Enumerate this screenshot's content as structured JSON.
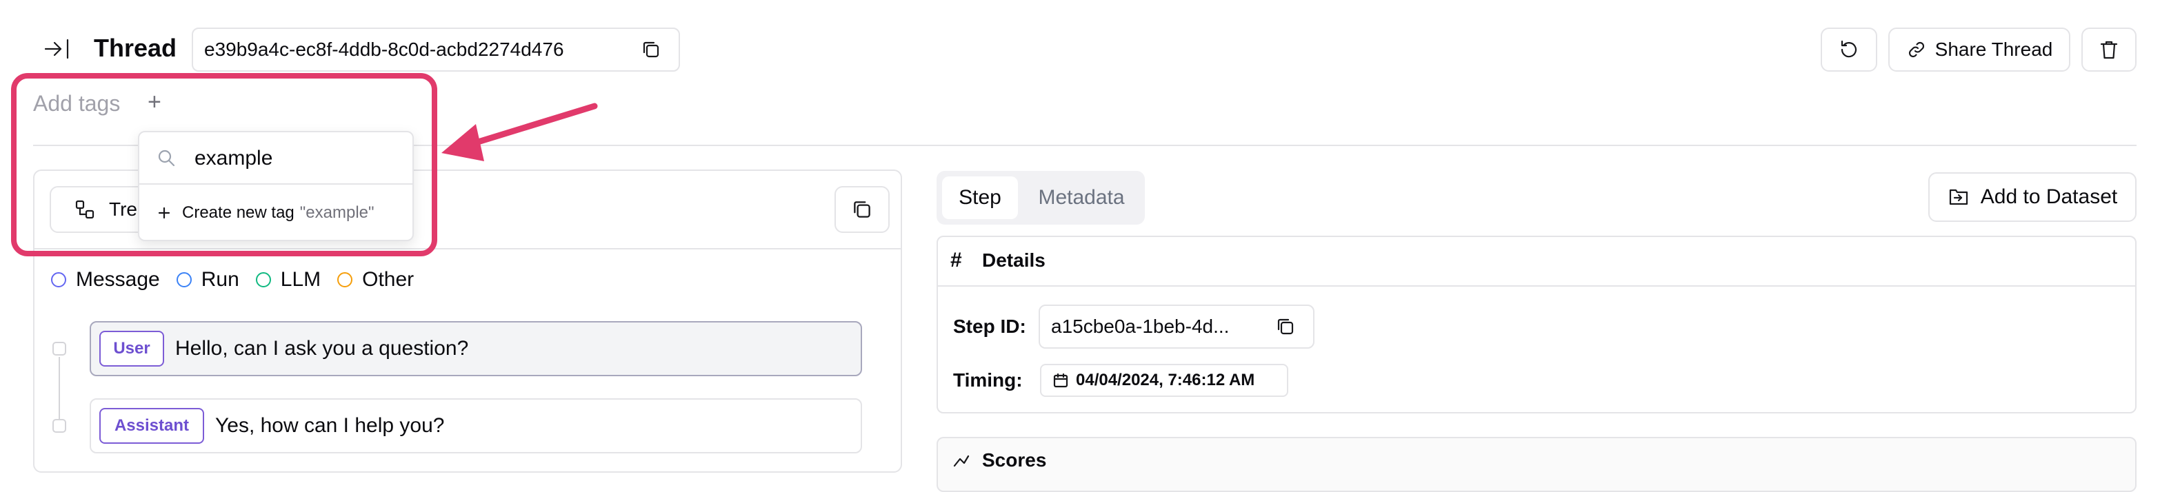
{
  "header": {
    "title": "Thread",
    "thread_id": "e39b9a4c-ec8f-4ddb-8c0d-acbd2274d476",
    "share_label": "Share Thread"
  },
  "tags": {
    "placeholder": "Add tags",
    "plus": "+",
    "dropdown": {
      "search_value": "example",
      "create_prefix": "Create new tag",
      "create_value": "\"example\""
    }
  },
  "left_panel": {
    "tree_tab_label": "Tree",
    "legend": [
      {
        "label": "Message",
        "color": "#6366f1"
      },
      {
        "label": "Run",
        "color": "#3b82f6"
      },
      {
        "label": "LLM",
        "color": "#10b981"
      },
      {
        "label": "Other",
        "color": "#f59e0b"
      }
    ],
    "messages": [
      {
        "role": "User",
        "text": "Hello, can I ask you a question?"
      },
      {
        "role": "Assistant",
        "text": "Yes, how can I help you?"
      }
    ]
  },
  "right_panel": {
    "tabs": [
      {
        "label": "Step",
        "active": true
      },
      {
        "label": "Metadata",
        "active": false
      }
    ],
    "add_dataset_label": "Add to Dataset",
    "details_title": "Details",
    "step_id_label": "Step ID:",
    "step_id_value": "a15cbe0a-1beb-4d...",
    "timing_label": "Timing:",
    "timing_value": "04/04/2024, 7:46:12 AM",
    "scores_title": "Scores"
  },
  "colors": {
    "annotation": "#e13a6b",
    "role_pill": "#7c5cd6",
    "border": "#e4e4e7"
  }
}
